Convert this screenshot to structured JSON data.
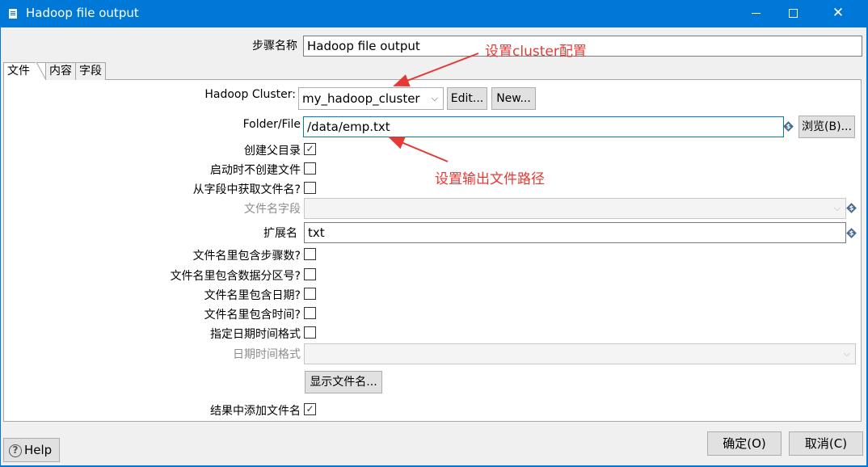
{
  "window": {
    "title": "Hadoop file output",
    "icon": "document-icon",
    "controls": {
      "minimize": "minimize-icon",
      "maximize": "maximize-icon",
      "close": "✕"
    }
  },
  "step_name": {
    "label": "步骤名称",
    "value": "Hadoop file output"
  },
  "tabs": [
    {
      "label": "文件",
      "active": true
    },
    {
      "label": "内容",
      "active": false
    },
    {
      "label": "字段",
      "active": false
    }
  ],
  "file_tab": {
    "hadoop_cluster": {
      "label": "Hadoop Cluster:",
      "selected": "my_hadoop_cluster",
      "edit_label": "Edit...",
      "new_label": "New..."
    },
    "folder_file": {
      "label": "Folder/File",
      "value": "/data/emp.txt",
      "browse_label": "浏览(B)..."
    },
    "create_parent_folder": {
      "label": "创建父目录",
      "checked": true
    },
    "no_create_at_start": {
      "label": "启动时不创建文件",
      "checked": false
    },
    "filename_from_field": {
      "label": "从字段中获取文件名?",
      "checked": false
    },
    "filename_field": {
      "label": "文件名字段",
      "value": ""
    },
    "extension": {
      "label": "扩展名",
      "value": "txt"
    },
    "include_stepnr": {
      "label": "文件名里包含步骤数?",
      "checked": false
    },
    "include_partition": {
      "label": "文件名里包含数据分区号?",
      "checked": false
    },
    "include_date": {
      "label": "文件名里包含日期?",
      "checked": false
    },
    "include_time": {
      "label": "文件名里包含时间?",
      "checked": false
    },
    "specify_datetime_format": {
      "label": "指定日期时间格式",
      "checked": false
    },
    "datetime_format": {
      "label": "日期时间格式",
      "value": ""
    },
    "show_filenames_label": "显示文件名...",
    "add_to_result": {
      "label": "结果中添加文件名",
      "checked": true
    }
  },
  "annotations": {
    "cluster": "设置cluster配置",
    "path": "设置输出文件路径",
    "color": "#e53935"
  },
  "footer": {
    "help_label": "Help",
    "ok_label": "确定(O)",
    "cancel_label": "取消(C)"
  }
}
